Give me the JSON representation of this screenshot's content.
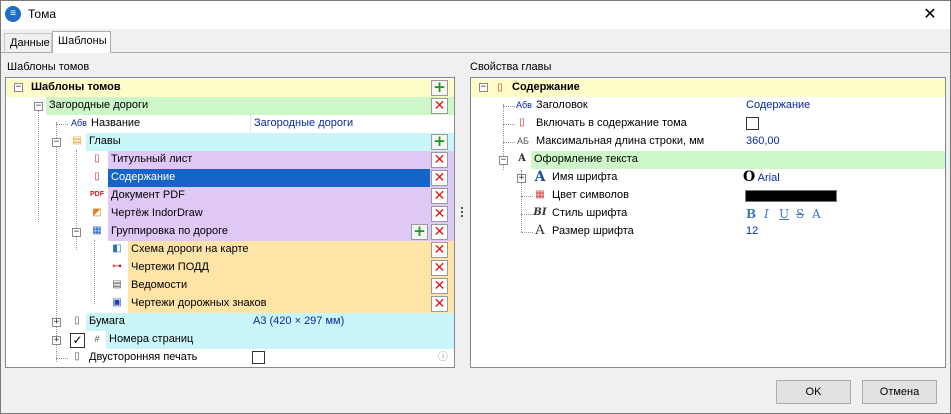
{
  "window": {
    "title": "Тома"
  },
  "tabs": [
    {
      "label": "Данные"
    },
    {
      "label": "Шаблоны"
    }
  ],
  "left": {
    "heading": "Шаблоны томов",
    "root": "Шаблоны томов",
    "road": "Загородные дороги",
    "name_label": "Название",
    "name_value": "Загородные дороги",
    "chapters": "Главы",
    "items": [
      "Титульный лист",
      "Содержание",
      "Документ PDF",
      "Чертёж IndorDraw",
      "Группировка по дороге"
    ],
    "subitems": [
      "Схема дороги на карте",
      "Чертежи ПОДД",
      "Ведомости",
      "Чертежи дорожных знаков"
    ],
    "paper_label": "Бумага",
    "paper_value": "А3 (420 × 297 мм)",
    "pagenum_label": "Номера страниц",
    "duplex_label": "Двусторонняя печать",
    "icon_abv": "Абв"
  },
  "right": {
    "heading": "Свойства главы",
    "root": "Содержание",
    "rows": [
      {
        "label": "Заголовок",
        "value": "Содержание"
      },
      {
        "label": "Включать в содержание тома",
        "value": ""
      },
      {
        "label": "Максимальная длина строки, мм",
        "value": "360,00"
      }
    ],
    "text_format": "Оформление текста",
    "font_name_label": "Имя шрифта",
    "font_name_value": "Arial",
    "color_label": "Цвет символов",
    "style_label": "Стиль шрифта",
    "size_label": "Размер шрифта",
    "size_value": "12",
    "style_buttons": [
      "B",
      "I",
      "U",
      "S",
      "A"
    ],
    "icon_abv": "Абв",
    "icon_ab": "АБ"
  },
  "buttons": {
    "ok": "OK",
    "cancel": "Отмена"
  },
  "colors": {
    "yellow": "#fefcc8",
    "green": "#cdf7c8",
    "cyan": "#c9f7f9",
    "purple": "#dfc8f5",
    "orange": "#ffe4a8",
    "selected": "#1565c8"
  }
}
